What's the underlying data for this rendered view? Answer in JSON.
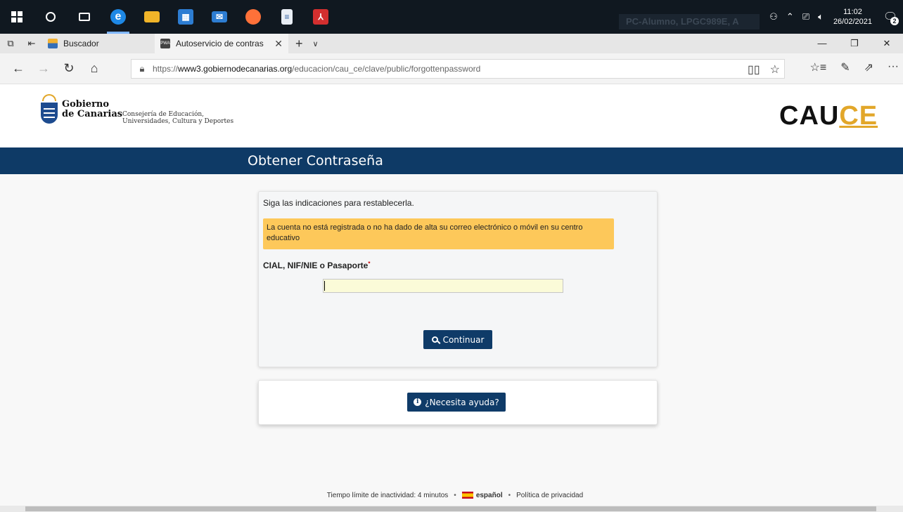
{
  "taskbar": {
    "apps": [
      {
        "name": "start-button",
        "icon": "windows-logo-icon"
      },
      {
        "name": "search-button",
        "icon": "cortana-icon"
      },
      {
        "name": "task-view-button",
        "icon": "task-view-icon"
      },
      {
        "name": "edge-app",
        "icon": "edge-icon",
        "color": "#1e88e5"
      },
      {
        "name": "file-explorer-app",
        "icon": "folder-icon",
        "color": "#f0b429"
      },
      {
        "name": "store-app",
        "icon": "store-icon",
        "color": "#2d7dd2"
      },
      {
        "name": "mail-app",
        "icon": "mail-icon",
        "color": "#2d7dd2"
      },
      {
        "name": "firefox-app",
        "icon": "firefox-icon",
        "color": "#ff7139"
      },
      {
        "name": "notepad-app",
        "icon": "document-icon",
        "color": "#e9eef5"
      },
      {
        "name": "acrobat-app",
        "icon": "pdf-icon",
        "color": "#d32f2f"
      }
    ],
    "blurred_user": "PC-Alumno, LPGC989E, A",
    "clock_time": "11:02",
    "clock_date": "26/02/2021",
    "notification_count": "2"
  },
  "browser": {
    "tabs": [
      {
        "label": "Buscador",
        "active": false
      },
      {
        "label": "Autoservicio de contras",
        "active": true
      }
    ],
    "favicon_pwa_text": "PWA",
    "url_prefix": "https://",
    "url_domain": "www3.gobiernodecanarias.org",
    "url_path": "/educacion/cau_ce/clave/public/forgottenpassword"
  },
  "header": {
    "org_line1": "Gobierno",
    "org_line2": "de Canarias",
    "dept_line1": "Consejería de Educación,",
    "dept_line2": "Universidades, Cultura y Deportes",
    "brand_main": "CAU",
    "brand_accent": "CE"
  },
  "page": {
    "title": "Obtener Contraseña",
    "intro": "Siga las indicaciones para restablecerla.",
    "alert": "La cuenta no está registrada o no ha dado de alta su correo electrónico o móvil en su centro educativo",
    "field_label": "CIAL, NIF/NIE o Pasaporte",
    "required_mark": "*",
    "field_value": "",
    "continue_label": "Continuar",
    "help_label": "¿Necesita ayuda?"
  },
  "footer": {
    "timeout": "Tiempo límite de inactividad: 4 minutos",
    "language": "español",
    "privacy": "Política de privacidad"
  },
  "colors": {
    "title_band": "#0e3a66",
    "button": "#0f3b68",
    "alert_bg": "#fdc85a",
    "brand_accent": "#e2a72a"
  }
}
